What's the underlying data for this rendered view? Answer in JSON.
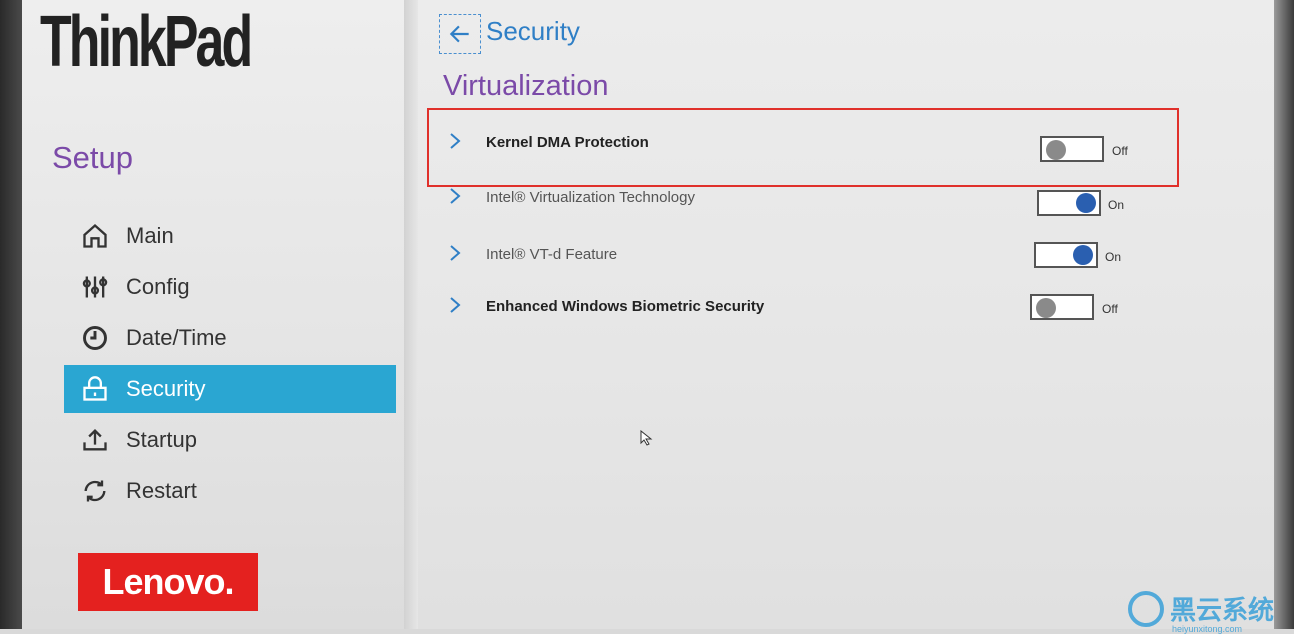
{
  "brand": {
    "thinkpad": "ThinkPad",
    "lenovo": "Lenovo."
  },
  "sidebar": {
    "title": "Setup",
    "items": [
      {
        "label": "Main",
        "icon": "home-icon",
        "active": false
      },
      {
        "label": "Config",
        "icon": "sliders-icon",
        "active": false
      },
      {
        "label": "Date/Time",
        "icon": "clock-icon",
        "active": false
      },
      {
        "label": "Security",
        "icon": "lock-icon",
        "active": true
      },
      {
        "label": "Startup",
        "icon": "upload-icon",
        "active": false
      },
      {
        "label": "Restart",
        "icon": "refresh-icon",
        "active": false
      }
    ]
  },
  "header": {
    "breadcrumb": "Security",
    "section": "Virtualization"
  },
  "settings": [
    {
      "label": "Kernel DMA Protection",
      "state": "Off",
      "on": false
    },
    {
      "label": "Intel® Virtualization Technology",
      "state": "On",
      "on": true
    },
    {
      "label": "Intel® VT-d Feature",
      "state": "On",
      "on": true
    },
    {
      "label": "Enhanced Windows Biometric Security",
      "state": "Off",
      "on": false
    }
  ],
  "colors": {
    "accent_purple": "#7b4aa8",
    "active_blue": "#2aa6d2",
    "toggle_on": "#2a5fb0",
    "highlight_red": "#e0302b",
    "lenovo_red": "#e4211f"
  },
  "watermark": {
    "text": "黑云系统",
    "sub": "heiyunxitong.com"
  }
}
